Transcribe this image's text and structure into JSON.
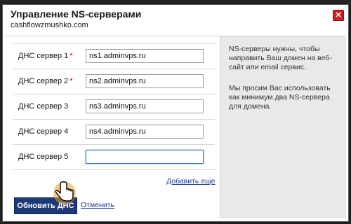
{
  "dialog": {
    "title": "Управление NS-серверами",
    "domain": "cashflowzmushko.com",
    "close_icon": "close-icon",
    "close_glyph": "✕"
  },
  "form": {
    "required_mark": "*",
    "rows": [
      {
        "label": "ДНС сервер 1",
        "value": "ns1.adminvps.ru",
        "required": true
      },
      {
        "label": "ДНС сервер 2",
        "value": "ns2.adminvps.ru",
        "required": true
      },
      {
        "label": "ДНС сервер 3",
        "value": "ns3.adminvps.ru",
        "required": false
      },
      {
        "label": "ДНС сервер 4",
        "value": "ns4.adminvps.ru",
        "required": false
      },
      {
        "label": "ДНС сервер 5",
        "value": "",
        "required": false
      }
    ],
    "add_more_label": "Добавить еще",
    "submit_label": "Обновить ДНС",
    "cancel_label": "Отменить"
  },
  "info": {
    "paragraph1": "NS-серверы нужны, чтобы направить Ваш домен на веб-сайт или email сервис.",
    "paragraph2": "Мы просим Вас использовать как минимум два NS-сервера для домена."
  },
  "colors": {
    "close": "#d42020",
    "submit": "#1d3a78",
    "link": "#1a3a8f",
    "info_bg": "#e9e9e9"
  }
}
